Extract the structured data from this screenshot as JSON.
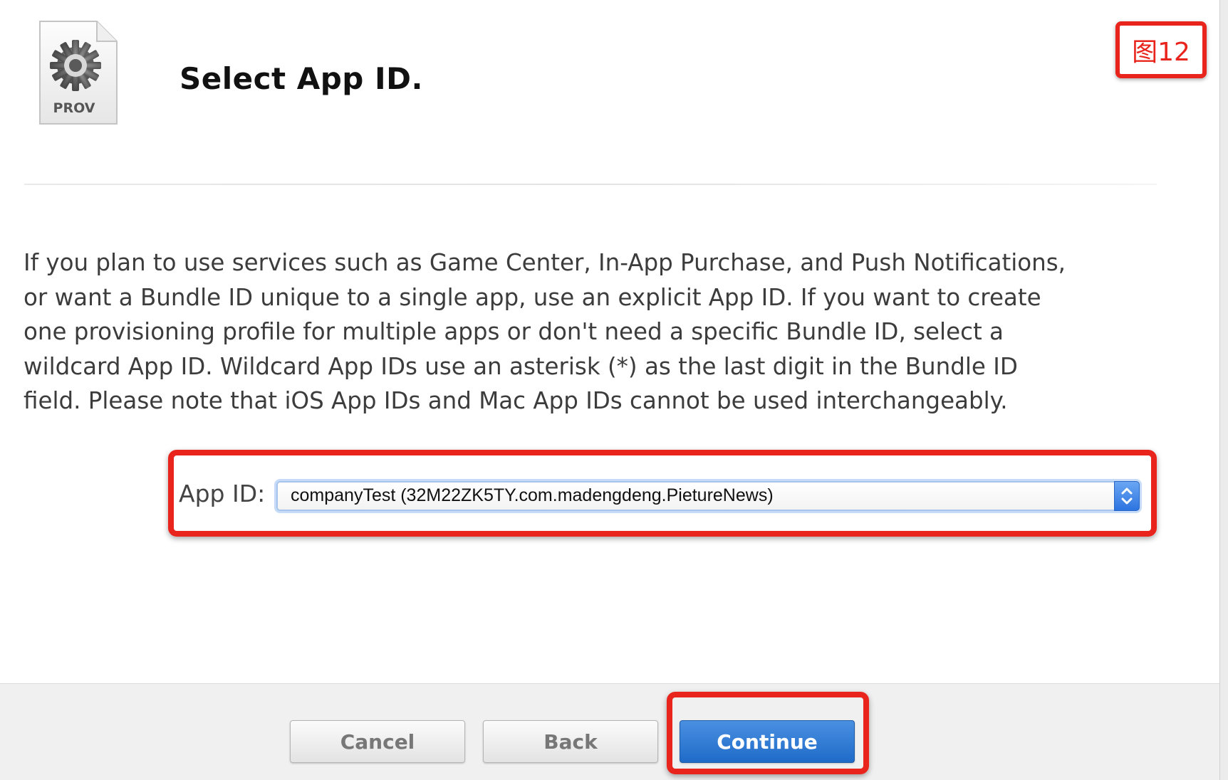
{
  "header": {
    "file_icon_label": "PROV",
    "title": "Select App ID."
  },
  "annotation": {
    "figure_label": "图12",
    "highlight_color": "#e8241c"
  },
  "description": "If you plan to use services such as Game Center, In-App Purchase, and Push Notifications, or want a Bundle ID unique to a single app, use an explicit App ID. If you want to create one provisioning profile for multiple apps or don't need a specific Bundle ID, select a wildcard App ID. Wildcard App IDs use an asterisk (*) as the last digit in the Bundle ID field. Please note that iOS App IDs and Mac App IDs cannot be used interchangeably.",
  "app_id": {
    "label": "App ID:",
    "selected_value": "companyTest (32M22ZK5TY.com.madengdeng.PietureNews)",
    "stepper_icon": "up-down-chevron-icon"
  },
  "footer": {
    "cancel_label": "Cancel",
    "back_label": "Back",
    "continue_label": "Continue"
  },
  "colors": {
    "primary_button": "#2d74e0",
    "focus_ring": "#a7c4ec"
  }
}
